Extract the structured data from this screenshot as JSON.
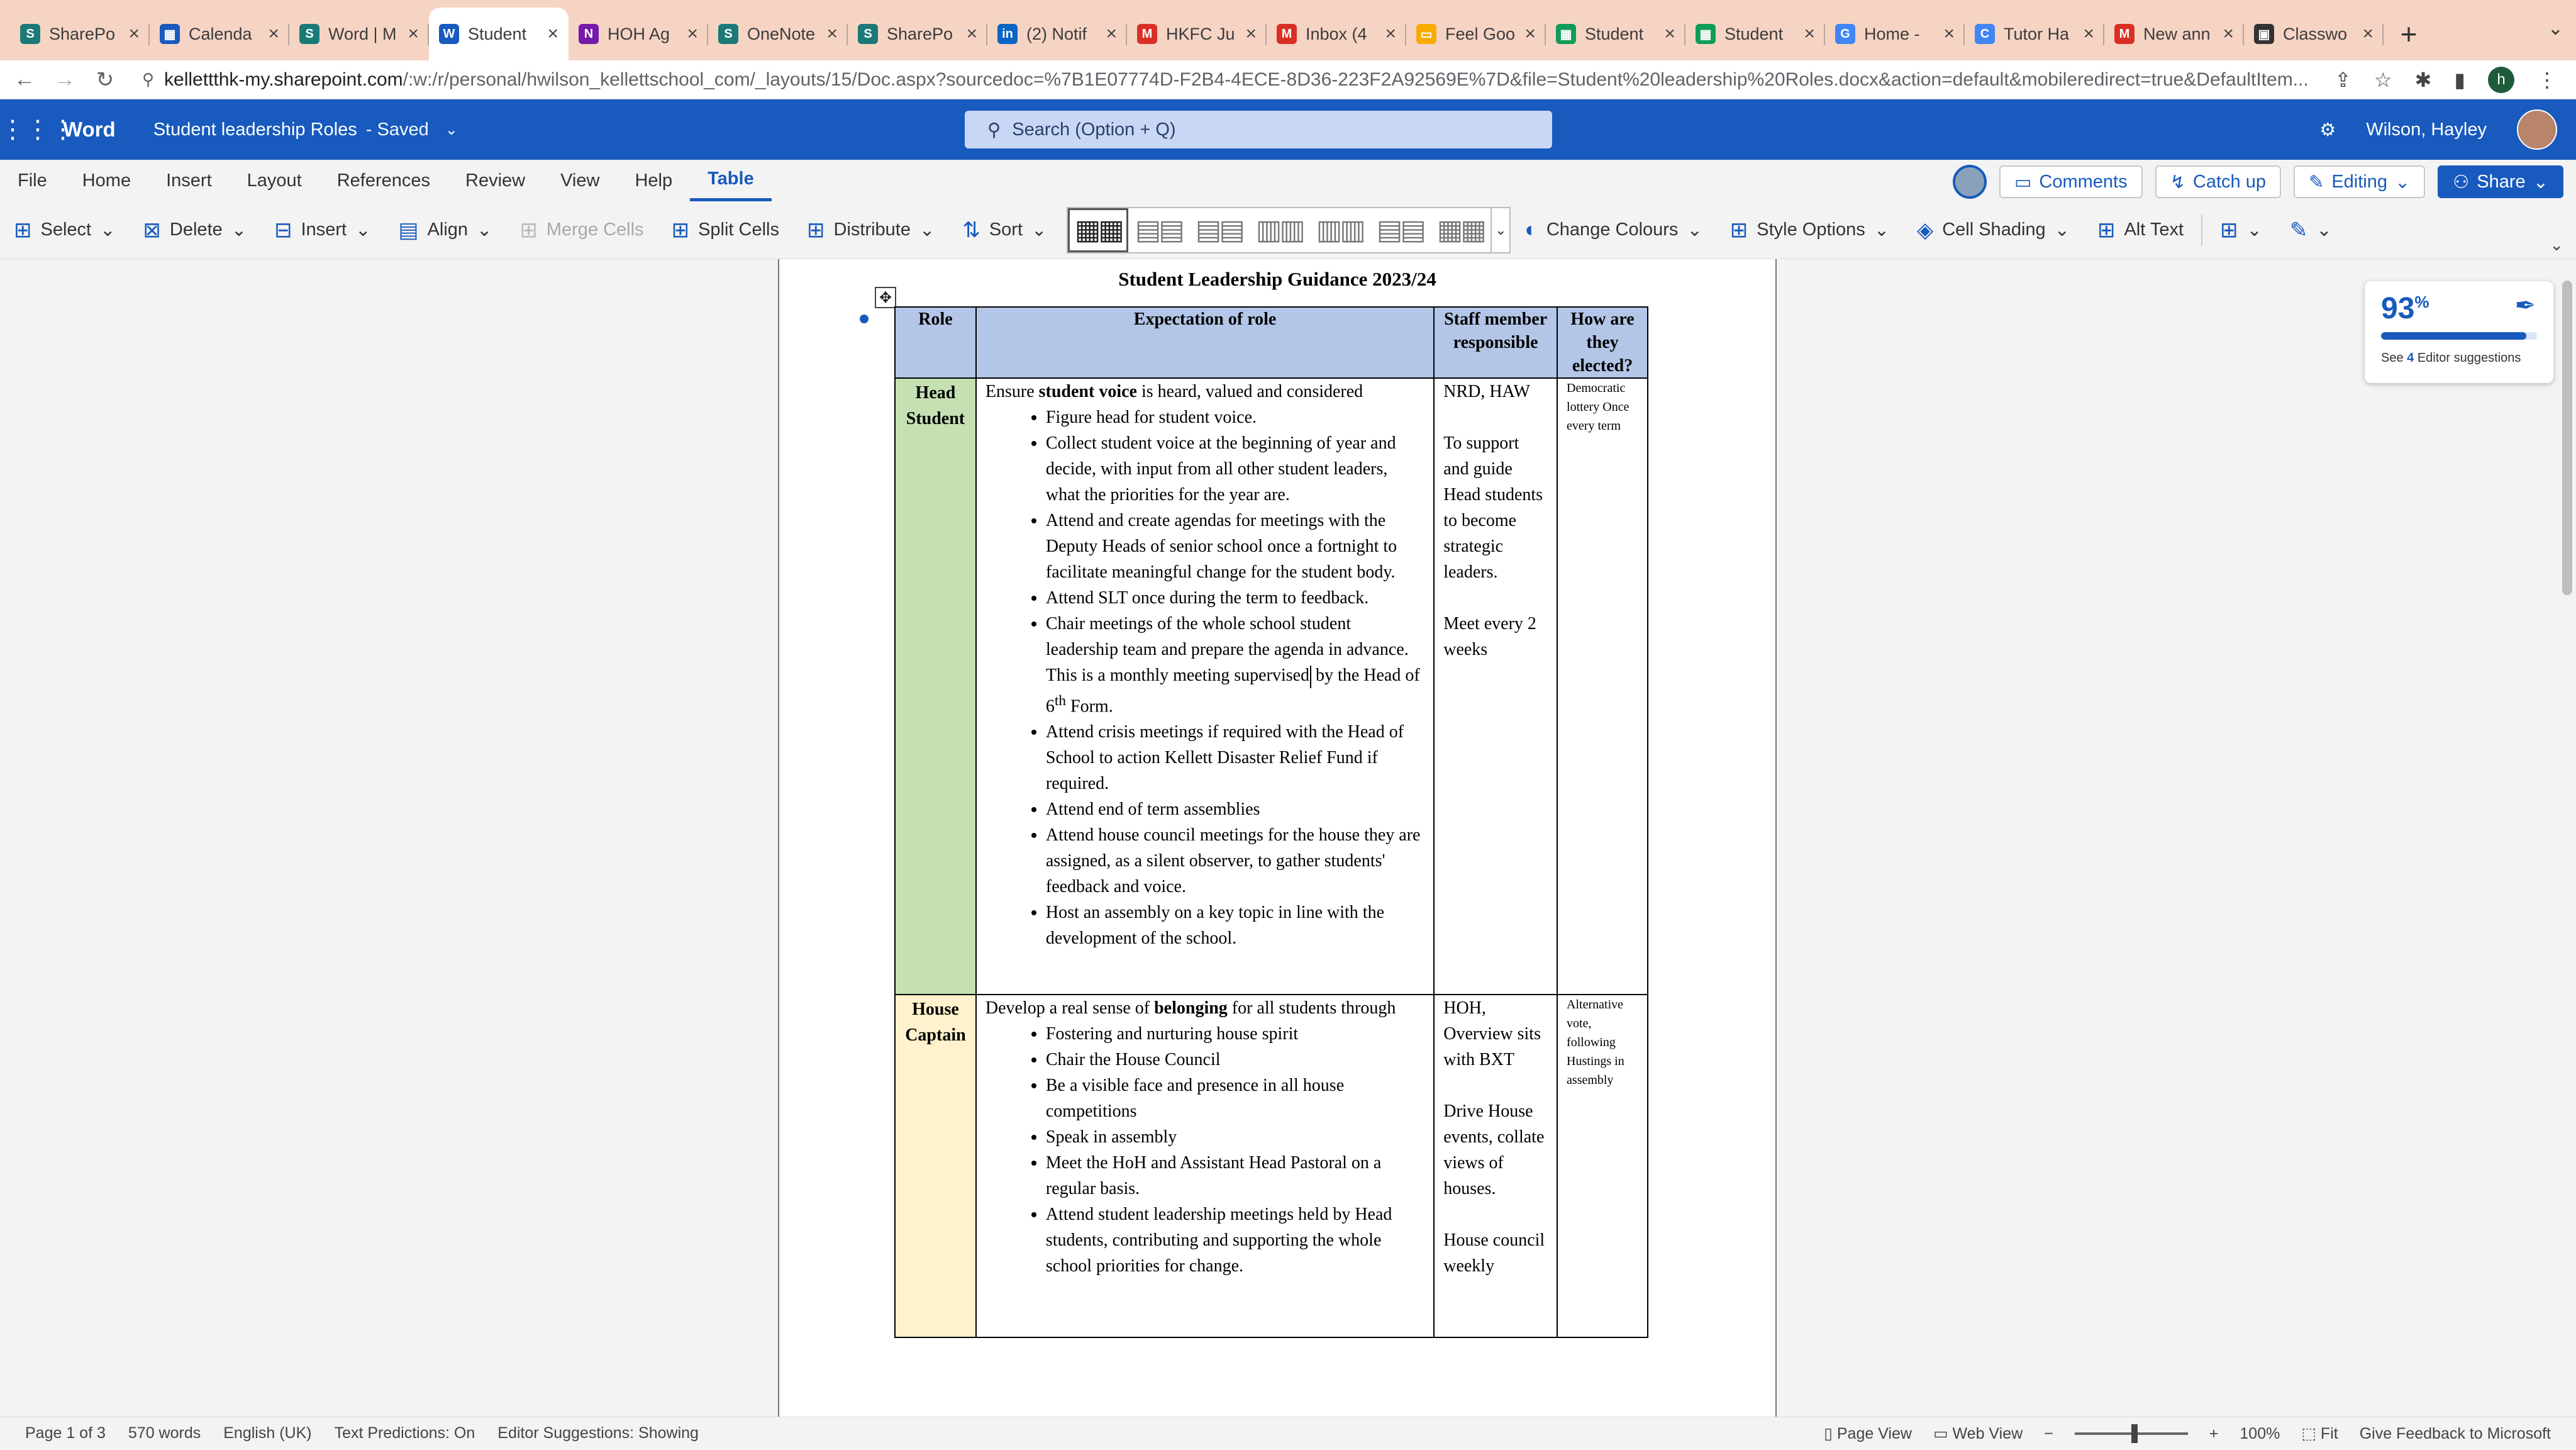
{
  "browser": {
    "tabs": [
      {
        "title": "SharePo",
        "color": "#1b7a78",
        "glyph": "S",
        "active": false
      },
      {
        "title": "Calenda",
        "color": "#185abd",
        "glyph": "▦",
        "active": false
      },
      {
        "title": "Word | M",
        "color": "#1b7a78",
        "glyph": "S",
        "active": false
      },
      {
        "title": "Student",
        "color": "#185abd",
        "glyph": "W",
        "active": true
      },
      {
        "title": "HOH Ag",
        "color": "#7719aa",
        "glyph": "N",
        "active": false
      },
      {
        "title": "OneNote",
        "color": "#1b7a78",
        "glyph": "S",
        "active": false
      },
      {
        "title": "SharePo",
        "color": "#1b7a78",
        "glyph": "S",
        "active": false
      },
      {
        "title": "(2) Notif",
        "color": "#0a66c2",
        "glyph": "in",
        "active": false
      },
      {
        "title": "HKFC Ju",
        "color": "#d93025",
        "glyph": "M",
        "active": false
      },
      {
        "title": "Inbox (4",
        "color": "#d93025",
        "glyph": "M",
        "active": false
      },
      {
        "title": "Feel Goo",
        "color": "#f9ab00",
        "glyph": "▭",
        "active": false
      },
      {
        "title": "Student",
        "color": "#0f9d58",
        "glyph": "▦",
        "active": false
      },
      {
        "title": "Student",
        "color": "#0f9d58",
        "glyph": "▦",
        "active": false
      },
      {
        "title": "Home -",
        "color": "#4285f4",
        "glyph": "G",
        "active": false
      },
      {
        "title": "Tutor Ha",
        "color": "#4285f4",
        "glyph": "C",
        "active": false
      },
      {
        "title": "New ann",
        "color": "#d93025",
        "glyph": "M",
        "active": false
      },
      {
        "title": "Classwo",
        "color": "#333333",
        "glyph": "▣",
        "active": false
      }
    ],
    "url_domain": "kellettthk-my.sharepoint.com",
    "url_path": "/:w:/r/personal/hwilson_kellettschool_com/_layouts/15/Doc.aspx?sourcedoc=%7B1E07774D-F2B4-4ECE-8D36-223F2A92569E%7D&file=Student%20leadership%20Roles.docx&action=default&mobileredirect=true&DefaultItem...",
    "profile_initial": "h"
  },
  "word": {
    "app_name": "Word",
    "doc_title": "Student leadership Roles",
    "save_status": "-  Saved",
    "search_placeholder": "Search (Option + Q)",
    "user_name": "Wilson, Hayley"
  },
  "menu": {
    "items": [
      "File",
      "Home",
      "Insert",
      "Layout",
      "References",
      "Review",
      "View",
      "Help",
      "Table"
    ],
    "active": "Table",
    "comments": "Comments",
    "catch_up": "Catch up",
    "editing": "Editing",
    "share": "Share"
  },
  "ribbon": {
    "select": "Select",
    "delete": "Delete",
    "insert": "Insert",
    "align": "Align",
    "merge_cells": "Merge Cells",
    "split_cells": "Split Cells",
    "distribute": "Distribute",
    "sort": "Sort",
    "change_colours": "Change Colours",
    "style_options": "Style Options",
    "cell_shading": "Cell Shading",
    "alt_text": "Alt Text"
  },
  "document": {
    "title": "Student Leadership Guidance 2023/24",
    "headers": [
      "Role",
      "Expectation of role",
      "Staff member responsible",
      "How are they elected?"
    ],
    "rows": [
      {
        "role": "Head Student",
        "intro_prefix": "Ensure ",
        "intro_bold": "student voice",
        "intro_suffix": " is heard, valued and considered",
        "bullets": [
          "Figure head for student voice.",
          "Collect student voice at the beginning of year and decide, with input from all other student leaders, what the priorities for the year are.",
          "Attend and create agendas for meetings with the Deputy Heads of senior school once a fortnight to facilitate meaningful change for the student body.",
          "Attend SLT once during the term to feedback.",
          "Chair meetings of the whole school student leadership team and prepare the agenda in advance. This is a monthly meeting supervised",
          "Attend crisis meetings if required with the Head of School to action Kellett Disaster Relief Fund if required.",
          "Attend end of term assemblies",
          "Attend house council meetings for the house they are assigned, as a silent observer, to gather students' feedback and voice.",
          "Host an assembly on a key topic in line with the development of the school."
        ],
        "bullet5_cont_prefix": "by the Head of 6",
        "bullet5_cont_sup": "th",
        "bullet5_cont_suffix": " Form.",
        "staff": [
          "NRD, HAW",
          "To support and guide Head students to become strategic leaders.",
          "Meet every 2 weeks"
        ],
        "how": "Democratic lottery Once every term"
      },
      {
        "role": "House Captain",
        "intro_prefix": "Develop a real sense of ",
        "intro_bold": "belonging",
        "intro_suffix": " for all students through",
        "bullets": [
          "Fostering and nurturing house spirit",
          "Chair the House Council",
          "Be a visible face and presence in all house competitions",
          "Speak in assembly",
          "Meet the HoH and Assistant Head Pastoral on a regular basis.",
          "Attend student leadership meetings held by Head students, contributing and supporting the whole school priorities for change."
        ],
        "staff": [
          "HOH, Overview sits with BXT",
          "Drive House events, collate views of houses.",
          "House council weekly"
        ],
        "how": "Alternative vote, following Hustings in assembly"
      }
    ]
  },
  "editor": {
    "score": "93",
    "score_unit": "%",
    "score_fraction": 0.93,
    "suggestions_prefix": "See ",
    "suggestions_count": "4",
    "suggestions_suffix": " Editor suggestions"
  },
  "status": {
    "page": "Page 1 of 3",
    "words": "570 words",
    "language": "English (UK)",
    "predictions": "Text Predictions: On",
    "editor_suggestions": "Editor Suggestions: Showing",
    "page_view": "Page View",
    "web_view": "Web View",
    "zoom": "100%",
    "fit": "Fit",
    "feedback": "Give Feedback to Microsoft"
  },
  "colors": {
    "word_blue": "#185abd",
    "header_fill": "#b4c6e7",
    "head_student_fill": "#c5e0b3",
    "house_captain_fill": "#fff2cc",
    "tabstrip": "#f6d4c4"
  }
}
